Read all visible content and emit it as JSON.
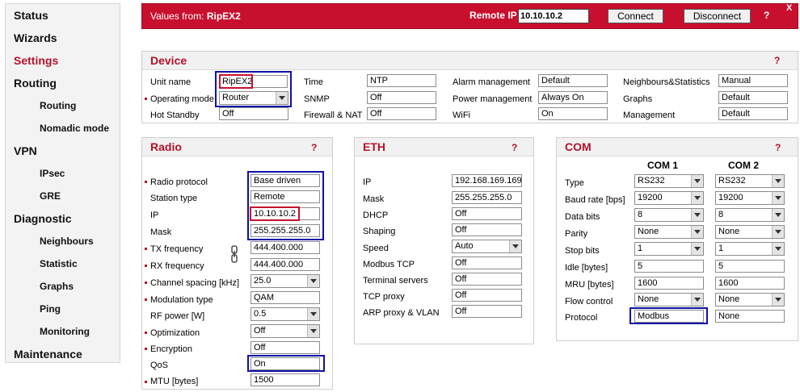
{
  "sidebar": {
    "status": "Status",
    "wizards": "Wizards",
    "settings": "Settings",
    "routing": "Routing",
    "routing_sub": "Routing",
    "nomadic": "Nomadic mode",
    "vpn": "VPN",
    "ipsec": "IPsec",
    "gre": "GRE",
    "diagnostic": "Diagnostic",
    "neighbours": "Neighbours",
    "statistic": "Statistic",
    "graphs": "Graphs",
    "ping": "Ping",
    "monitoring": "Monitoring",
    "maintenance": "Maintenance"
  },
  "header": {
    "values_from": "Values from: ",
    "unit": "RipEX2",
    "remote_ip_label": "Remote IP",
    "remote_ip": "10.10.10.2",
    "connect": "Connect",
    "disconnect": "Disconnect",
    "help": "?",
    "close": "X"
  },
  "device": {
    "title": "Device",
    "help": "?",
    "unit_name_label": "Unit name",
    "unit_name": "RipEX2",
    "operating_mode_label": "Operating mode",
    "operating_mode": "Router",
    "hot_standby_label": "Hot Standby",
    "hot_standby": "Off",
    "time_label": "Time",
    "time": "NTP",
    "snmp_label": "SNMP",
    "snmp": "Off",
    "firewall_label": "Firewall & NAT",
    "firewall": "Off",
    "alarm_label": "Alarm management",
    "alarm": "Default",
    "power_label": "Power management",
    "power": "Always On",
    "wifi_label": "WiFi",
    "wifi": "On",
    "neigh_label": "Neighbours&Statistics",
    "neigh": "Manual",
    "graphs_label": "Graphs",
    "graphs": "Default",
    "mgmt_label": "Management",
    "mgmt": "Default"
  },
  "radio": {
    "title": "Radio",
    "help": "?",
    "rows": [
      {
        "label": "Radio protocol",
        "value": "Base driven"
      },
      {
        "label": "Station type",
        "value": "Remote"
      },
      {
        "label": "IP",
        "value": "10.10.10.2"
      },
      {
        "label": "Mask",
        "value": "255.255.255.0"
      },
      {
        "label": "TX frequency",
        "value": "444.400.000"
      },
      {
        "label": "RX frequency",
        "value": "444.400.000"
      },
      {
        "label": "Channel spacing [kHz]",
        "value": "25.0"
      },
      {
        "label": "Modulation type",
        "value": "QAM"
      },
      {
        "label": "RF power [W]",
        "value": "0.5"
      },
      {
        "label": "Optimization",
        "value": "Off"
      },
      {
        "label": "Encryption",
        "value": "Off"
      },
      {
        "label": "QoS",
        "value": "On"
      },
      {
        "label": "MTU [bytes]",
        "value": "1500"
      }
    ]
  },
  "eth": {
    "title": "ETH",
    "help": "?",
    "rows": [
      {
        "label": "IP",
        "value": "192.168.169.169"
      },
      {
        "label": "Mask",
        "value": "255.255.255.0"
      },
      {
        "label": "DHCP",
        "value": "Off"
      },
      {
        "label": "Shaping",
        "value": "Off"
      },
      {
        "label": "Speed",
        "value": "Auto"
      },
      {
        "label": "Modbus TCP",
        "value": "Off"
      },
      {
        "label": "Terminal servers",
        "value": "Off"
      },
      {
        "label": "TCP proxy",
        "value": "Off"
      },
      {
        "label": "ARP proxy & VLAN",
        "value": "Off"
      }
    ]
  },
  "com": {
    "title": "COM",
    "help": "?",
    "col1": "COM 1",
    "col2": "COM 2",
    "rows": [
      {
        "label": "Type",
        "c1": "RS232",
        "c2": "RS232"
      },
      {
        "label": "Baud rate [bps]",
        "c1": "19200",
        "c2": "19200"
      },
      {
        "label": "Data bits",
        "c1": "8",
        "c2": "8"
      },
      {
        "label": "Parity",
        "c1": "None",
        "c2": "None"
      },
      {
        "label": "Stop bits",
        "c1": "1",
        "c2": "1"
      },
      {
        "label": "Idle [bytes]",
        "c1": "5",
        "c2": "5"
      },
      {
        "label": "MRU [bytes]",
        "c1": "1600",
        "c2": "1600"
      },
      {
        "label": "Flow control",
        "c1": "None",
        "c2": "None"
      },
      {
        "label": "Protocol",
        "c1": "Modbus",
        "c2": "None"
      }
    ]
  },
  "colors": {
    "accent": "#c8102e",
    "highlight_blue": "#1010a8"
  }
}
